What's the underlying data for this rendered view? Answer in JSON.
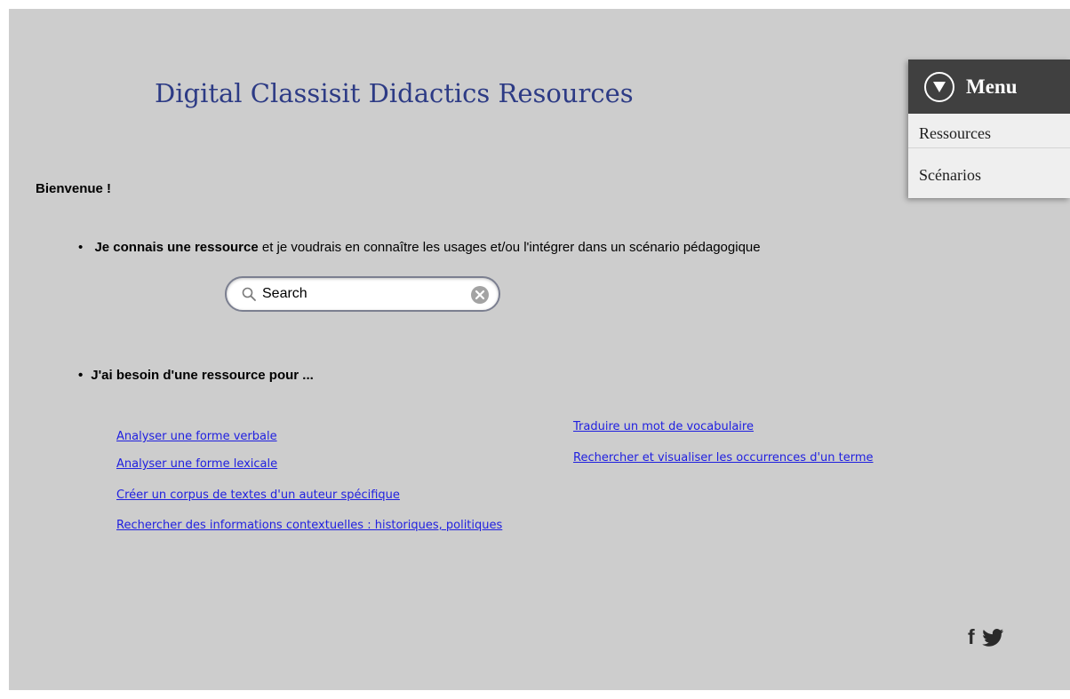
{
  "site": {
    "title": "Digital Classisit Didactics Resources"
  },
  "menu": {
    "label": "Menu",
    "icon": "chevron-down-circle-icon",
    "items": [
      {
        "label": "Ressources"
      },
      {
        "label": "Scénarios"
      }
    ]
  },
  "main": {
    "welcome": "Bienvenue !",
    "known_resource": {
      "bold": "Je connais une ressource",
      "rest": " et je voudrais en connaître les usages et/ou l'intégrer dans un scénario pédagogique"
    },
    "search": {
      "value": "Search"
    },
    "need_resource": "J'ai besoin d'une ressource pour ...",
    "links_left": [
      "Analyser une forme verbale",
      "Analyser une forme lexicale",
      "Créer un corpus de textes d'un auteur spécifique",
      "Rechercher des informations contextuelles : historiques, politiques"
    ],
    "links_right": [
      "Traduire un mot de vocabulaire",
      "Rechercher et visualiser les occurrences d'un terme"
    ]
  },
  "footer": {
    "facebook": "f",
    "icons": [
      "facebook-icon",
      "twitter-icon"
    ]
  },
  "colors": {
    "background": "#cdcdcd",
    "title": "#2d3b85",
    "menu_header": "#404040",
    "link": "#1f1fe0"
  }
}
